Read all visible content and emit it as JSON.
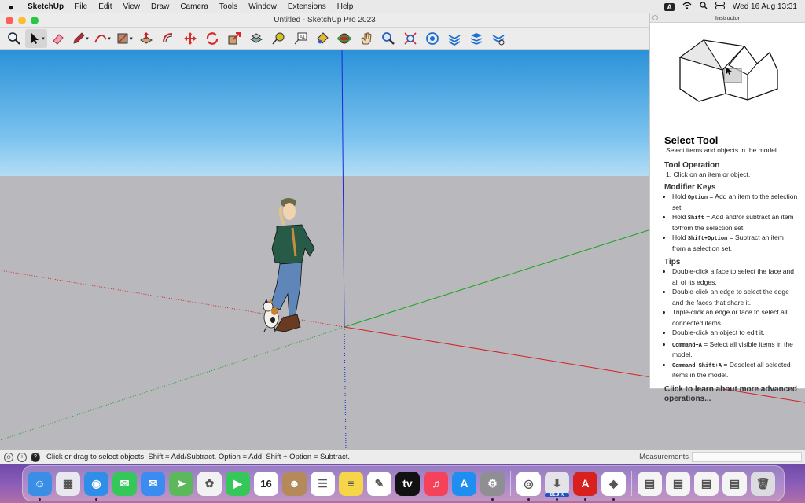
{
  "menubar": {
    "app": "SketchUp",
    "items": [
      "File",
      "Edit",
      "View",
      "Draw",
      "Camera",
      "Tools",
      "Window",
      "Extensions",
      "Help"
    ],
    "input_badge": "A",
    "datetime": "Wed 16 Aug  13:31"
  },
  "window": {
    "title": "Untitled - SketchUp Pro 2023",
    "traffic_lights": {
      "close": "#fe5f57",
      "minimize": "#febc2e",
      "zoom": "#28c840"
    }
  },
  "toolbar": {
    "tools": [
      "zoom-icon",
      "select-arrow-icon",
      "eraser-icon",
      "pencil-icon",
      "arc-icon",
      "shape-icon",
      "push-pull-icon",
      "offset-icon",
      "move-icon",
      "rotate-icon",
      "scale-icon",
      "follow-me-icon",
      "tape-measure-icon",
      "text-icon",
      "paint-bucket-icon",
      "orbit-icon",
      "pan-icon",
      "zoom-tool-icon",
      "zoom-extents-icon",
      "warehouse-icon",
      "extension-warehouse-icon",
      "layout-icon",
      "tags-icon"
    ]
  },
  "instructor": {
    "window_title": "Instructor",
    "heading": "Select Tool",
    "intro": "Select items and objects in the model.",
    "operation_title": "Tool Operation",
    "operation_step": "1. Click on an item or object.",
    "modifier_title": "Modifier Keys",
    "modifiers": [
      {
        "pre": "Hold ",
        "key": "Option",
        "post": " = Add an item to the selection set."
      },
      {
        "pre": "Hold ",
        "key": "Shift",
        "post": " = Add and/or subtract an item to/from the selection set."
      },
      {
        "pre": "Hold ",
        "key": "Shift+Option",
        "post": " = Subtract an item from a selection set."
      }
    ],
    "tips_title": "Tips",
    "tips": [
      {
        "pre": "",
        "key": "",
        "post": "Double-click a face to select the face and all of its edges."
      },
      {
        "pre": "",
        "key": "",
        "post": "Double-click an edge to select the edge and the faces that share it."
      },
      {
        "pre": "",
        "key": "",
        "post": "Triple-click an edge or face to select all connected items."
      },
      {
        "pre": "",
        "key": "",
        "post": "Double-click an object to edit it."
      },
      {
        "pre": "",
        "key": "Command+A",
        "post": " = Select all visible items in the model."
      },
      {
        "pre": "",
        "key": "Command+Shift+A",
        "post": " = Deselect all selected items in the model."
      }
    ],
    "more_link": "Click to learn about more advanced operations..."
  },
  "statusbar": {
    "hint": "Click or drag to select objects. Shift = Add/Subtract. Option = Add. Shift + Option = Subtract.",
    "measurements_label": "Measurements",
    "measurements_value": ""
  },
  "dock": {
    "apps": [
      {
        "name": "finder-icon",
        "color": "#3a8ee6",
        "glyph": "☺",
        "running": true
      },
      {
        "name": "launchpad-icon",
        "color": "#e8e8ee",
        "glyph": "▦",
        "running": false
      },
      {
        "name": "safari-icon",
        "color": "#2f8fe8",
        "glyph": "◉",
        "running": true
      },
      {
        "name": "messages-icon",
        "color": "#35c759",
        "glyph": "✉",
        "running": false
      },
      {
        "name": "mail-icon",
        "color": "#3b8cf0",
        "glyph": "✉",
        "running": false
      },
      {
        "name": "maps-icon",
        "color": "#5bb85b",
        "glyph": "➤",
        "running": false
      },
      {
        "name": "photos-icon",
        "color": "#f2f2f2",
        "glyph": "✿",
        "running": false
      },
      {
        "name": "facetime-icon",
        "color": "#35c759",
        "glyph": "▶",
        "running": false
      },
      {
        "name": "calendar-icon",
        "color": "#ffffff",
        "glyph": "16",
        "running": false
      },
      {
        "name": "contacts-icon",
        "color": "#b58a5a",
        "glyph": "☻",
        "running": false
      },
      {
        "name": "reminders-icon",
        "color": "#ffffff",
        "glyph": "☰",
        "running": false
      },
      {
        "name": "notes-icon",
        "color": "#f7d548",
        "glyph": "≡",
        "running": false
      },
      {
        "name": "freeform-icon",
        "color": "#ffffff",
        "glyph": "✎",
        "running": false
      },
      {
        "name": "apple-tv-icon",
        "color": "#111111",
        "glyph": "tv",
        "running": false
      },
      {
        "name": "music-icon",
        "color": "#f5425a",
        "glyph": "♫",
        "running": false
      },
      {
        "name": "app-store-icon",
        "color": "#1f8ef1",
        "glyph": "A",
        "running": false
      },
      {
        "name": "system-settings-icon",
        "color": "#8e8e93",
        "glyph": "⚙",
        "running": true
      },
      {
        "name": "chrome-icon",
        "color": "#ffffff",
        "glyph": "◎",
        "running": true
      },
      {
        "name": "downloads-icon",
        "color": "#e3e3e8",
        "glyph": "⬇",
        "running": true,
        "badge": "81.9 K"
      },
      {
        "name": "acrobat-icon",
        "color": "#d8201f",
        "glyph": "A",
        "running": true
      },
      {
        "name": "sketchup-icon",
        "color": "#ffffff",
        "glyph": "◆",
        "running": true
      },
      {
        "name": "screenshot-thumb-1-icon",
        "color": "#f4f4f4",
        "glyph": "▤",
        "running": false
      },
      {
        "name": "screenshot-thumb-2-icon",
        "color": "#f4f4f4",
        "glyph": "▤",
        "running": false
      },
      {
        "name": "screenshot-thumb-3-icon",
        "color": "#f4f4f4",
        "glyph": "▤",
        "running": false
      },
      {
        "name": "screenshot-thumb-4-icon",
        "color": "#f4f4f4",
        "glyph": "▤",
        "running": false
      },
      {
        "name": "trash-icon",
        "color": "#dcdce0",
        "glyph": "🗑",
        "running": false
      }
    ]
  }
}
